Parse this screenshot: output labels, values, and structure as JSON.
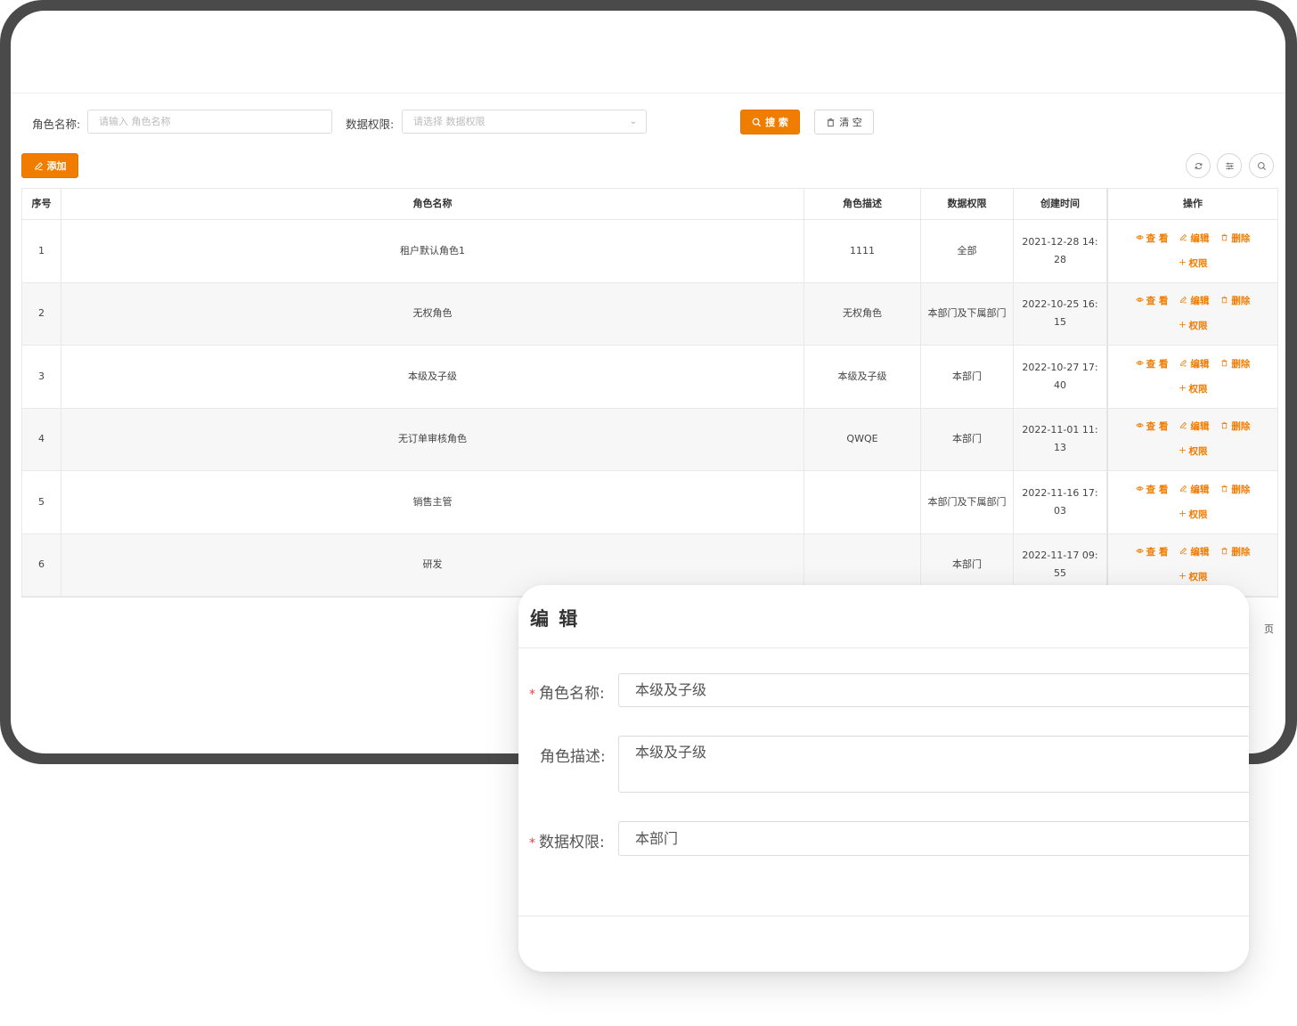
{
  "colors": {
    "accent": "#f07c00",
    "frame": "#4a4a4a"
  },
  "search": {
    "role_name_label": "角色名称:",
    "role_name_placeholder": "请输入 角色名称",
    "data_perm_label": "数据权限:",
    "data_perm_placeholder": "请选择 数据权限",
    "search_button": "搜 索",
    "clear_button": "清 空"
  },
  "toolbar": {
    "add_button": "添加",
    "icons": [
      "refresh-icon",
      "columns-settings-icon",
      "search-toggle-icon"
    ]
  },
  "table": {
    "columns": [
      "序号",
      "角色名称",
      "角色描述",
      "数据权限",
      "创建时间",
      "操作"
    ],
    "actions": {
      "view": "查 看",
      "edit": "编辑",
      "delete": "删除",
      "permission": "权限"
    },
    "rows": [
      {
        "index": "1",
        "name": "租户默认角色1",
        "desc": "1111",
        "perm": "全部",
        "created": "2021-12-28 14:28"
      },
      {
        "index": "2",
        "name": "无权角色",
        "desc": "无权角色",
        "perm": "本部门及下属部门",
        "created": "2022-10-25 16:15"
      },
      {
        "index": "3",
        "name": "本级及子级",
        "desc": "本级及子级",
        "perm": "本部门",
        "created": "2022-10-27 17:40"
      },
      {
        "index": "4",
        "name": "无订单审核角色",
        "desc": "QWQE",
        "perm": "本部门",
        "created": "2022-11-01 11:13"
      },
      {
        "index": "5",
        "name": "销售主管",
        "desc": "",
        "perm": "本部门及下属部门",
        "created": "2022-11-16 17:03"
      },
      {
        "index": "6",
        "name": "研发",
        "desc": "",
        "perm": "本部门",
        "created": "2022-11-17 09:55"
      }
    ]
  },
  "pagination": {
    "page_suffix": "页"
  },
  "modal": {
    "title": "编 辑",
    "required_mark": "*",
    "fields": {
      "role_name": {
        "label": "角色名称:",
        "value": "本级及子级"
      },
      "role_desc": {
        "label": "角色描述:",
        "value": "本级及子级"
      },
      "data_perm": {
        "label": "数据权限:",
        "value": "本部门"
      }
    }
  }
}
